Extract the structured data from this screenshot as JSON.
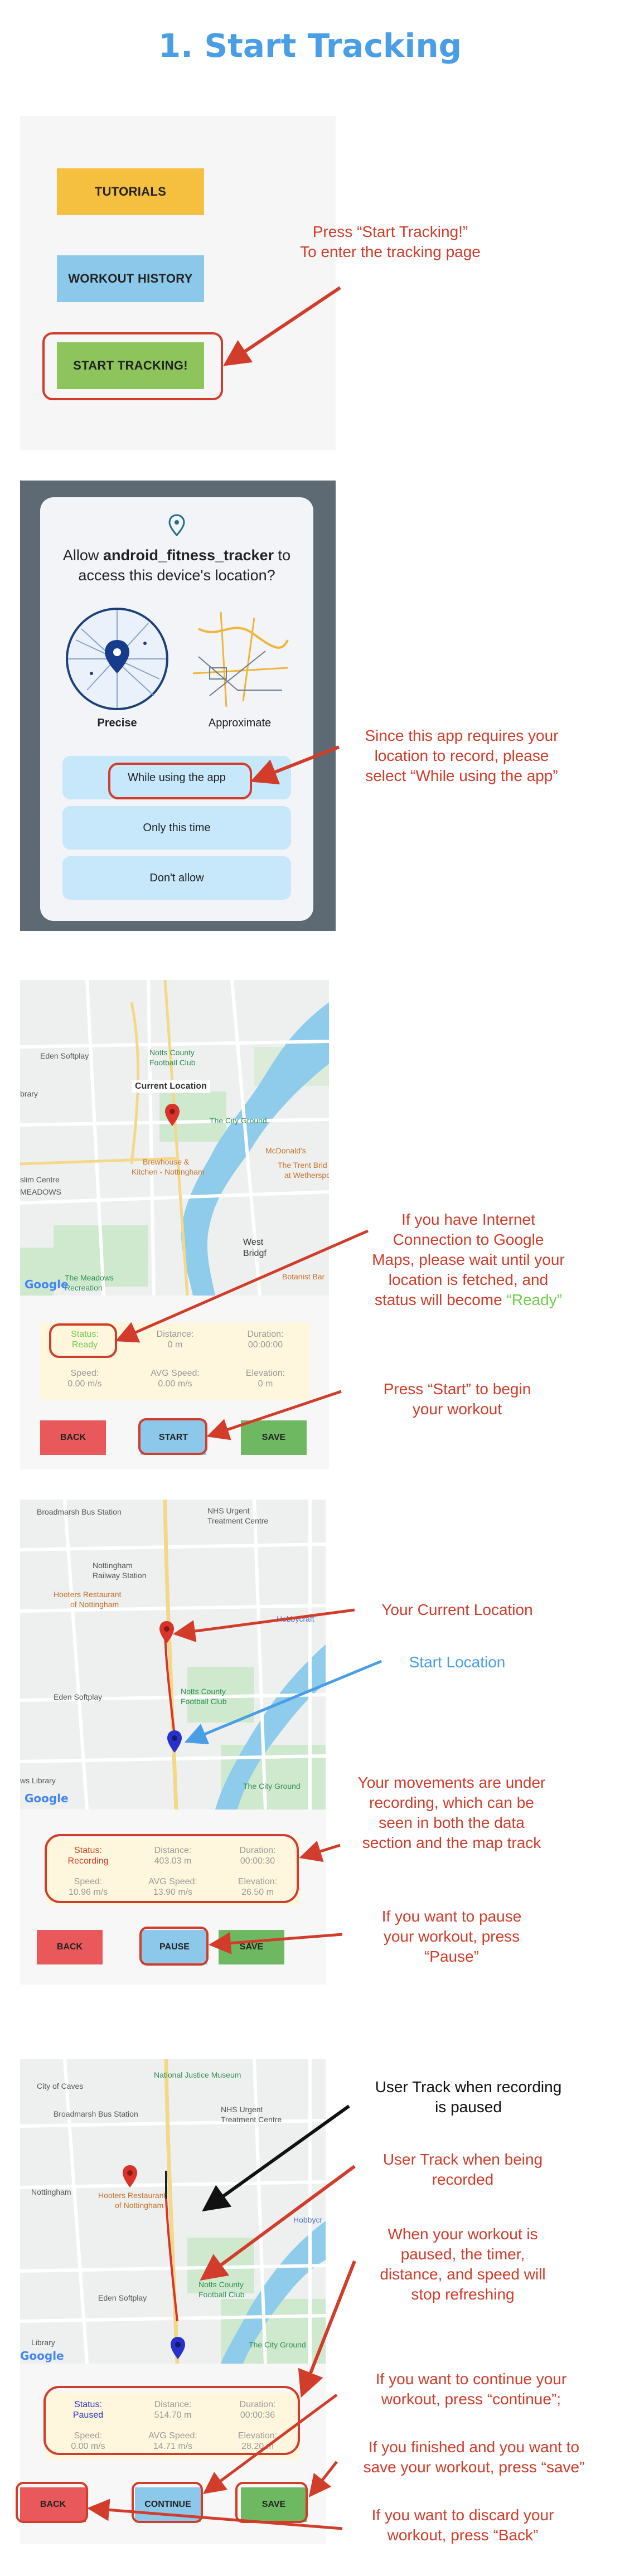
{
  "title": "1. Start Tracking",
  "annotations": {
    "press_start_1": "Press “Start Tracking!”",
    "press_start_2": "To enter the tracking page",
    "permission_1": "Since this app requires your",
    "permission_2": "location to record, please",
    "permission_3": "select “While using the app”",
    "internet_1": "If you have Internet",
    "internet_2": "Connection to Google",
    "internet_3": "Maps, please wait until your",
    "internet_4": "location is fetched, and",
    "internet_5a": "status will become ",
    "internet_5b": "“Ready”",
    "press_begin_1": "Press “Start” to begin",
    "press_begin_2": "your workout",
    "current_location": "Your Current Location",
    "start_location": "Start Location",
    "recording_1": "Your movements are under",
    "recording_2": "recording, which can be",
    "recording_3": "seen in both the data",
    "recording_4": "section and the map track",
    "pause_1": "If you want to pause",
    "pause_2": "your workout, press",
    "pause_3": "“Pause”",
    "paused_track_1": "User Track when recording",
    "paused_track_2": "is paused",
    "rec_track_1": "User Track when being",
    "rec_track_2": "recorded",
    "stopped_1": "When your workout is",
    "stopped_2": "paused, the timer,",
    "stopped_3": "distance, and speed will",
    "stopped_4": "stop refreshing",
    "continue_1": "If you want to continue your",
    "continue_2": "workout, press “continue”;",
    "save_1": "If you finished and you want to",
    "save_2": "save your workout, press “save”",
    "back_1": "If you want to discard your",
    "back_2": "workout, press “Back”"
  },
  "screen1": {
    "tutorials": "TUTORIALS",
    "history": "WORKOUT HISTORY",
    "start": "START TRACKING!"
  },
  "screen2": {
    "prompt_pre": "Allow ",
    "app_name": "android_fitness_tracker",
    "prompt_post": " to access this device's location?",
    "precise": "Precise",
    "approximate": "Approximate",
    "while_using": "While using the app",
    "only_this_time": "Only this time",
    "dont_allow": "Don't allow"
  },
  "screen3": {
    "map_labels": {
      "eden": "Eden Softplay",
      "notts1": "Notts County",
      "notts2": "Football Club",
      "current": "Current Location",
      "city_ground": "The City Ground",
      "brewhouse1": "Brewhouse &",
      "brewhouse2": "Kitchen - Nottingham",
      "meadows": "MEADOWS",
      "mcdonalds": "McDonald's",
      "trent1": "The Trent Brid",
      "trent2": "at Wetherspo",
      "west1": "West",
      "west2": "Bridgf",
      "meadows_school1": "The Meadows",
      "meadows_school2": "Recreation",
      "slim": "slim Centre",
      "library": "brary",
      "botanist": "Botanist Bar",
      "google": "Google"
    },
    "status_label": "Status:",
    "status_value": "Ready",
    "distance_label": "Distance:",
    "distance_value": "0 m",
    "duration_label": "Duration:",
    "duration_value": "00:00:00",
    "speed_label": "Speed:",
    "speed_value": "0.00 m/s",
    "avg_label": "AVG Speed:",
    "avg_value": "0.00 m/s",
    "elev_label": "Elevation:",
    "elev_value": "0 m",
    "back": "BACK",
    "start": "START",
    "save": "SAVE"
  },
  "screen4": {
    "map_labels": {
      "broadmarsh": "Broadmarsh Bus Station",
      "nhs1": "NHS Urgent",
      "nhs2": "Treatment Centre",
      "nottingham1": "Nottingham",
      "nottingham2": "Railway Station",
      "hooters1": "Hooters Restaurant",
      "hooters2": "of Nottingham",
      "hobbycraft": "Hobbycraft",
      "eden": "Eden Softplay",
      "notts1": "Notts County",
      "notts2": "Football Club",
      "city_ground": "The City Ground",
      "library": "ws Library",
      "google": "Google"
    },
    "status_label": "Status:",
    "status_value": "Recording",
    "distance_label": "Distance:",
    "distance_value": "403.03 m",
    "duration_label": "Duration:",
    "duration_value": "00:00:30",
    "speed_label": "Speed:",
    "speed_value": "10.96 m/s",
    "avg_label": "AVG Speed:",
    "avg_value": "13.90 m/s",
    "elev_label": "Elevation:",
    "elev_value": "26.50 m",
    "back": "BACK",
    "pause": "PAUSE",
    "save": "SAVE"
  },
  "screen5": {
    "map_labels": {
      "city_caves": "City of Caves",
      "justice": "National Justice Museum",
      "broadmarsh": "Broadmarsh Bus Station",
      "nhs1": "NHS Urgent",
      "nhs2": "Treatment Centre",
      "nottingham": "Nottingham",
      "hooters1": "Hooters Restaurant",
      "hooters2": "of Nottingham",
      "hobbycraft": "Hobbycr",
      "eden": "Eden Softplay",
      "notts1": "Notts County",
      "notts2": "Football Club",
      "city_ground": "The City Ground",
      "library": "Library",
      "google": "Google"
    },
    "status_label": "Status:",
    "status_value": "Paused",
    "distance_label": "Distance:",
    "distance_value": "514.70 m",
    "duration_label": "Duration:",
    "duration_value": "00:00:36",
    "speed_label": "Speed:",
    "speed_value": "0.00 m/s",
    "avg_label": "AVG Speed:",
    "avg_value": "14.71 m/s",
    "elev_label": "Elevation:",
    "elev_value": "28.20 m",
    "back": "BACK",
    "continue": "CONTINUE",
    "save": "SAVE"
  },
  "colors": {
    "title_blue": "#4a9ee6",
    "annotation_red": "#d23c2a",
    "ready_green": "#6ecf4a",
    "tutorials_yellow": "#f5bf3f",
    "history_blue": "#8cc8ea",
    "start_green": "#8dc45c",
    "info_bg": "#fff7dd"
  }
}
